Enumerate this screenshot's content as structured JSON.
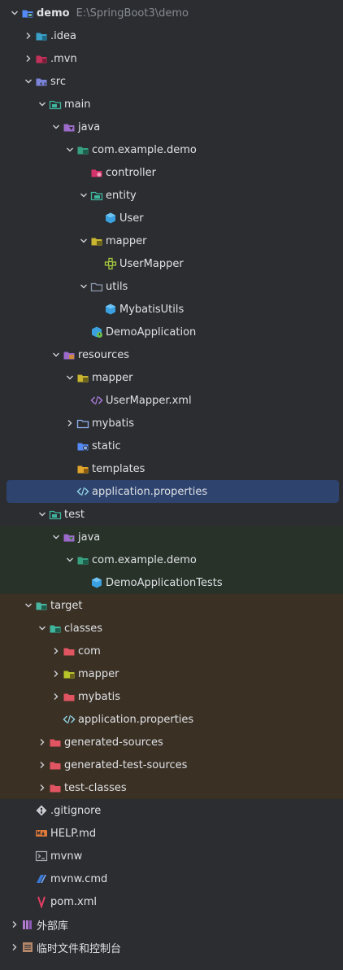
{
  "colors": {
    "background": "#2b2d30",
    "selection": "#2e436e",
    "test_band": "#283229",
    "excluded_band": "#3a3024",
    "text": "#dfe1e5",
    "path_text": "#868a91"
  },
  "tree": [
    {
      "label": "demo",
      "path": "E:\\SpringBoot3\\demo",
      "depth": 0,
      "chevron": "down",
      "icon": "module-folder",
      "bold": true
    },
    {
      "label": ".idea",
      "depth": 1,
      "chevron": "right",
      "icon": "idea-folder"
    },
    {
      "label": ".mvn",
      "depth": 1,
      "chevron": "right",
      "icon": "mvn-folder"
    },
    {
      "label": "src",
      "depth": 1,
      "chevron": "down",
      "icon": "src-folder"
    },
    {
      "label": "main",
      "depth": 2,
      "chevron": "down",
      "icon": "main-folder"
    },
    {
      "label": "java",
      "depth": 3,
      "chevron": "down",
      "icon": "java-source-folder"
    },
    {
      "label": "com.example.demo",
      "depth": 4,
      "chevron": "down",
      "icon": "package-folder"
    },
    {
      "label": "controller",
      "depth": 5,
      "chevron": "none",
      "icon": "controller-folder"
    },
    {
      "label": "entity",
      "depth": 5,
      "chevron": "down",
      "icon": "entity-folder"
    },
    {
      "label": "User",
      "depth": 6,
      "chevron": "none",
      "icon": "class-icon"
    },
    {
      "label": "mapper",
      "depth": 5,
      "chevron": "down",
      "icon": "mapper-folder"
    },
    {
      "label": "UserMapper",
      "depth": 6,
      "chevron": "none",
      "icon": "mapper-interface"
    },
    {
      "label": "utils",
      "depth": 5,
      "chevron": "down",
      "icon": "utils-folder"
    },
    {
      "label": "MybatisUtils",
      "depth": 6,
      "chevron": "none",
      "icon": "class-icon"
    },
    {
      "label": "DemoApplication",
      "depth": 5,
      "chevron": "none",
      "icon": "spring-app"
    },
    {
      "label": "resources",
      "depth": 3,
      "chevron": "down",
      "icon": "resources-folder"
    },
    {
      "label": "mapper",
      "depth": 4,
      "chevron": "down",
      "icon": "mapper-folder"
    },
    {
      "label": "UserMapper.xml",
      "depth": 5,
      "chevron": "none",
      "icon": "xml-file"
    },
    {
      "label": "mybatis",
      "depth": 4,
      "chevron": "right",
      "icon": "plain-folder"
    },
    {
      "label": "static",
      "depth": 4,
      "chevron": "none",
      "icon": "web-folder"
    },
    {
      "label": "templates",
      "depth": 4,
      "chevron": "none",
      "icon": "templates-folder"
    },
    {
      "label": "application.properties",
      "depth": 4,
      "chevron": "none",
      "icon": "properties-file",
      "selected": true
    },
    {
      "label": "test",
      "depth": 2,
      "chevron": "down",
      "icon": "test-folder"
    },
    {
      "label": "java",
      "depth": 3,
      "chevron": "down",
      "icon": "java-test-folder"
    },
    {
      "label": "com.example.demo",
      "depth": 4,
      "chevron": "down",
      "icon": "package-folder"
    },
    {
      "label": "DemoApplicationTests",
      "depth": 5,
      "chevron": "none",
      "icon": "class-icon"
    },
    {
      "label": "target",
      "depth": 1,
      "chevron": "down",
      "icon": "target-folder"
    },
    {
      "label": "classes",
      "depth": 2,
      "chevron": "down",
      "icon": "classes-folder"
    },
    {
      "label": "com",
      "depth": 3,
      "chevron": "right",
      "icon": "excluded-folder"
    },
    {
      "label": "mapper",
      "depth": 3,
      "chevron": "right",
      "icon": "excluded-mapper-folder"
    },
    {
      "label": "mybatis",
      "depth": 3,
      "chevron": "right",
      "icon": "excluded-folder"
    },
    {
      "label": "application.properties",
      "depth": 3,
      "chevron": "none",
      "icon": "properties-file"
    },
    {
      "label": "generated-sources",
      "depth": 2,
      "chevron": "right",
      "icon": "excluded-folder"
    },
    {
      "label": "generated-test-sources",
      "depth": 2,
      "chevron": "right",
      "icon": "excluded-folder"
    },
    {
      "label": "test-classes",
      "depth": 2,
      "chevron": "right",
      "icon": "excluded-folder"
    },
    {
      "label": ".gitignore",
      "depth": 1,
      "chevron": "none",
      "icon": "git-file"
    },
    {
      "label": "HELP.md",
      "depth": 1,
      "chevron": "none",
      "icon": "markdown-file"
    },
    {
      "label": "mvnw",
      "depth": 1,
      "chevron": "none",
      "icon": "shell-file"
    },
    {
      "label": "mvnw.cmd",
      "depth": 1,
      "chevron": "none",
      "icon": "cmd-file"
    },
    {
      "label": "pom.xml",
      "depth": 1,
      "chevron": "none",
      "icon": "maven-file"
    },
    {
      "label": "外部库",
      "depth": 0,
      "chevron": "right",
      "icon": "library-icon"
    },
    {
      "label": "临时文件和控制台",
      "depth": 0,
      "chevron": "right",
      "icon": "scratches-icon"
    }
  ]
}
